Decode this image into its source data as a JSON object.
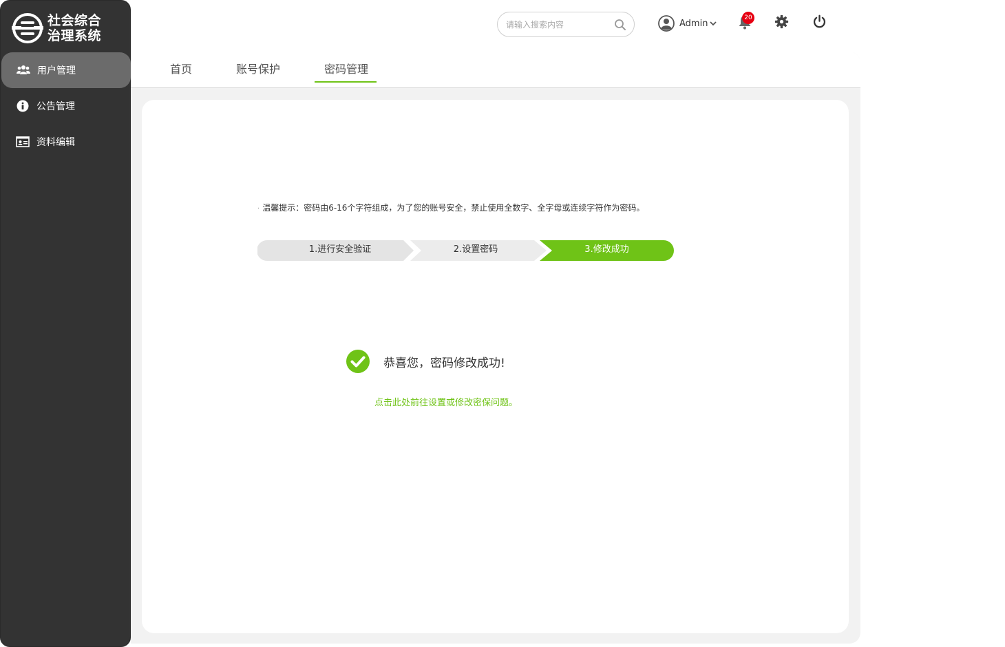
{
  "app": {
    "logo_line1": "社会综合",
    "logo_line2": "治理系统"
  },
  "sidebar": {
    "items": [
      {
        "label": "用户管理",
        "icon": "users-icon",
        "active": true
      },
      {
        "label": "公告管理",
        "icon": "info-icon",
        "active": false
      },
      {
        "label": "资料编辑",
        "icon": "id-card-icon",
        "active": false
      }
    ]
  },
  "header": {
    "search_placeholder": "请输入搜索内容",
    "user_name": "Admin",
    "notification_count": "20"
  },
  "tabs": [
    {
      "label": "首页",
      "active": false
    },
    {
      "label": "账号保护",
      "active": false
    },
    {
      "label": "密码管理",
      "active": true
    }
  ],
  "main": {
    "tip": "温馨提示：密码由6-16个字符组成，为了您的账号安全，禁止使用全数字、全字母或连续字符作为密码。",
    "steps": [
      {
        "label": "1.进行安全验证",
        "state": "done"
      },
      {
        "label": "2.设置密码",
        "state": "done"
      },
      {
        "label": "3.修改成功",
        "state": "current"
      }
    ],
    "success_message": "恭喜您，密码修改成功!",
    "security_link": "点击此处前往设置或修改密保问题。"
  },
  "colors": {
    "accent": "#6fc317",
    "sidebar_bg": "#333333",
    "sidebar_active": "#6b6b6b",
    "badge": "#e60012",
    "step_inactive": "#e6e6e6"
  }
}
